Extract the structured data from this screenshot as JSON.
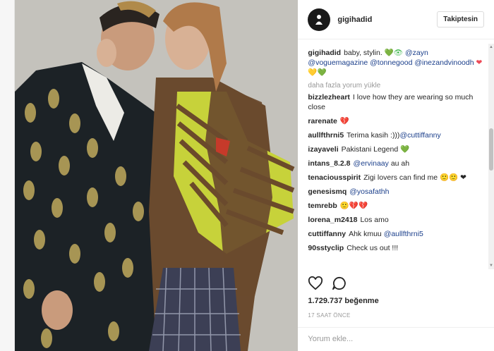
{
  "header": {
    "username": "gigihadid",
    "follow_label": "Takiptesin"
  },
  "caption": {
    "user": "gigihadid",
    "text_parts": [
      "baby, stylin. ",
      "💚👁 ",
      "@zayn",
      " ",
      "@voguemagazine",
      " ",
      "@tonnegood",
      " ",
      "@inezandvinoodh",
      " ",
      "❤💛💚"
    ]
  },
  "load_more_label": "daha fazla yorum yükle",
  "comments": [
    {
      "user": "bizzlezheart",
      "text": "I love how they are wearing so much close"
    },
    {
      "user": "rarenate",
      "text": "💔"
    },
    {
      "user": "aullfthrni5",
      "text": "Terima kasih :)))",
      "mention": "@cuttiffanny"
    },
    {
      "user": "izayaveli",
      "text": "Pakistani Legend",
      "emoji": "💚"
    },
    {
      "user": "intans_8.2.8",
      "mention": "@ervinaay",
      "text": "au ah"
    },
    {
      "user": "tenaciousspirit",
      "text": "Zigi lovers can find me 🙂🙂 ❤"
    },
    {
      "user": "genesismq",
      "mention": "@yosafathh"
    },
    {
      "user": "temrebb",
      "text": "🙂💔💔"
    },
    {
      "user": "lorena_m2418",
      "text": "Los amo"
    },
    {
      "user": "cuttiffanny",
      "text": "Ahk kmuu",
      "mention": "@aullfthrni5"
    },
    {
      "user": "90sstyclip",
      "text": "Check us out !!!"
    }
  ],
  "actions": {
    "like_icon": "heart-outline-icon",
    "comment_icon": "comment-bubble-icon"
  },
  "likes": "1.729.737 beğenme",
  "time": "17 SAAT ÖNCE",
  "add_comment": {
    "placeholder": "Yorum ekle..."
  },
  "colors": {
    "mention": "#1b3f8b",
    "background": "#ffffff",
    "border": "#efefef"
  }
}
